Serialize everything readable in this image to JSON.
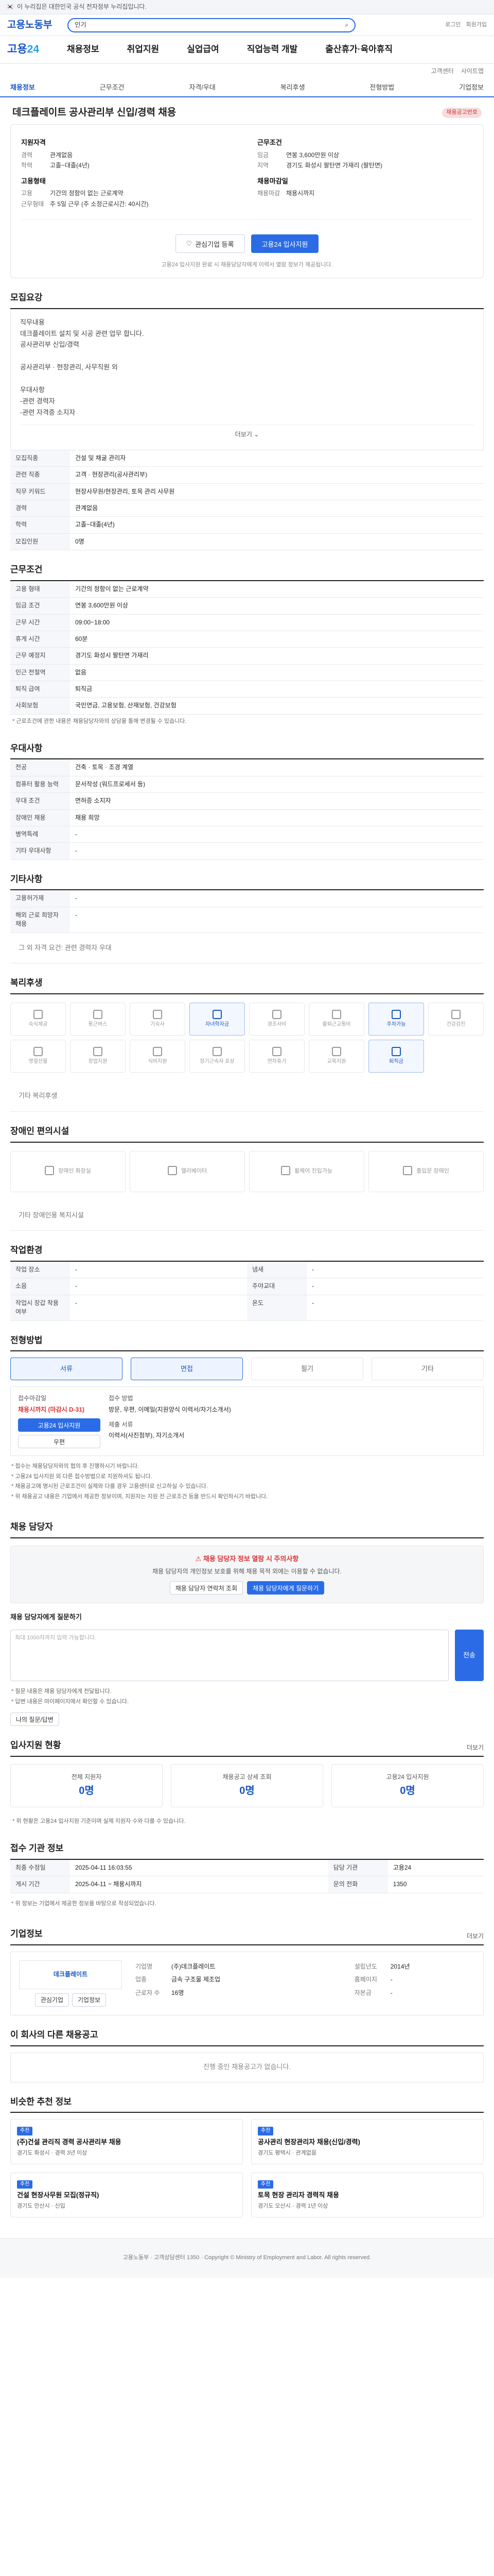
{
  "topbar": {
    "notice": "이 누리집은 대한민국 공식 전자정부 누리집입니다."
  },
  "gnb": {
    "logo": "고용노동부",
    "search_placeholder": "인기",
    "links": [
      "로그인",
      "회원가입"
    ]
  },
  "lnb": {
    "logo1": "고용",
    "logo2": "24",
    "items": [
      "채용정보",
      "취업지원",
      "실업급여",
      "직업능력 개발",
      "출산휴가·육아휴직"
    ]
  },
  "util": [
    "고객센터",
    "사이트맵"
  ],
  "subtabs": [
    "채용정보",
    "근무조건",
    "자격/우대",
    "복리후생",
    "전형방법",
    "기업정보"
  ],
  "notice": {
    "title": "데크플레이트 공사관리부 신입/경력 채용",
    "badge": "채용공고번호"
  },
  "corp": {
    "left_title": "지원자격",
    "left": [
      [
        "경력",
        "관계없음"
      ],
      [
        "학력",
        "고졸~대졸(4년)"
      ]
    ],
    "right_title": "근무조건",
    "right": [
      [
        "임금",
        "연봉 3,600만원 이상"
      ],
      [
        "지역",
        "경기도 화성시 팔탄면 가재리 (팔탄면)"
      ]
    ],
    "left2_title": "고용형태",
    "left2": [
      [
        "고용",
        "기간의 정함이 없는 근로계약"
      ],
      [
        "근무형태",
        "주 5일 근무 (주 소정근로시간: 40시간)"
      ]
    ],
    "right2_title": "채용마감일",
    "right2": [
      [
        "채용마감",
        "채용시까지"
      ]
    ]
  },
  "btns": {
    "save": "관심기업 등록",
    "apply": "고용24 입사지원"
  },
  "hint": "고용24 입사지원 완료 시 채용담당자에게 이력서 열람 정보가 제공됩니다.",
  "job_sect": {
    "title": "모집요강"
  },
  "job_desc": {
    "lines": [
      "직무내용",
      "데크플레이트 설치 및 시공 관련 업무 합니다.",
      "공사관리부 신입/경력",
      "",
      "공사관리부 · 현장관리, 사무직원 외",
      "",
      "우대사항",
      "-관련 경력자",
      "-관련 자격증 소지자"
    ],
    "toggle": "더보기"
  },
  "job_tbl": [
    [
      "모집직종",
      "건설 및 채굴 관리자"
    ],
    [
      "관련 직종",
      "고객 · 현장관리(공사관리부)"
    ],
    [
      "직무 키워드",
      "현장사무원/현장관리, 토목 관리 사무원"
    ],
    [
      "경력",
      "관계없음"
    ],
    [
      "학력",
      "고졸~대졸(4년)"
    ],
    [
      "모집인원",
      "0명"
    ]
  ],
  "cond_sect": {
    "title": "근무조건"
  },
  "cond_tbl": [
    [
      "고용 형태",
      "기간의 정함이 없는 근로계약"
    ],
    [
      "임금 조건",
      "연봉 3,600만원 이상"
    ],
    [
      "근무 시간",
      "09:00~18:00"
    ],
    [
      "휴게 시간",
      "60분"
    ],
    [
      "근무 예정지",
      "경기도 화성시 팔탄면 가재리"
    ],
    [
      "인근 전철역",
      "없음"
    ],
    [
      "퇴직 급여",
      "퇴직금"
    ],
    [
      "사회보험",
      "국민연금, 고용보험, 산재보험, 건강보험"
    ]
  ],
  "cond_note": "* 근로조건에 관한 내용은 채용담당자와의 상담을 통해 변경될 수 있습니다.",
  "pref_sect": {
    "title": "우대사항"
  },
  "pref_tbl": [
    [
      "전공",
      "건축 · 토목 · 조경 계열"
    ],
    [
      "컴퓨터 활용 능력",
      "문서작성 (워드프로세서 등)"
    ],
    [
      "우대 조건",
      "면허증 소지자"
    ],
    [
      "장애인 채용",
      "채용 희망"
    ],
    [
      "병역특례",
      "-"
    ],
    [
      "기타 우대사항",
      "-"
    ]
  ],
  "etc_sect": {
    "title": "기타사항"
  },
  "etc_tbl": [
    [
      "고용허가제",
      "-"
    ],
    [
      "해외 근로 희망자 채용",
      "-"
    ]
  ],
  "etc_note": "그 외 자격 요건: 관련 경력자 우대",
  "welfare_sect": {
    "title": "복리후생"
  },
  "welfare_items": [
    [
      "숙식제공",
      false
    ],
    [
      "통근버스",
      false
    ],
    [
      "기숙사",
      false
    ],
    [
      "자녀학자금",
      true
    ],
    [
      "경조사비",
      false
    ],
    [
      "출퇴근교통비",
      false
    ],
    [
      "주차가능",
      true
    ],
    [
      "건강검진",
      false
    ],
    [
      "명절선물",
      false
    ],
    [
      "창업지원",
      false
    ],
    [
      "식비지원",
      false
    ],
    [
      "장기근속자 포상",
      false
    ],
    [
      "연차휴가",
      false
    ],
    [
      "교육지원",
      false
    ],
    [
      "퇴직금",
      true
    ]
  ],
  "welfare_note": "기타 복리후생",
  "disab_sect": {
    "title": "장애인 편의시설"
  },
  "disab_items": [
    "장애인 화장실",
    "엘리베이터",
    "휠체어 진입가능",
    "출입문 장애인"
  ],
  "disab_note": "기타 장애인용 복지시설",
  "work_sect": {
    "title": "작업환경"
  },
  "work_tbl": [
    [
      "작업 장소",
      "-"
    ],
    [
      "소음",
      "-"
    ],
    [
      "작업시 장갑 착용 여부",
      "-"
    ],
    [
      "냄새",
      "-"
    ],
    [
      "주야교대",
      "-"
    ],
    [
      "온도",
      "-"
    ]
  ],
  "select_sect": {
    "title": "전형방법"
  },
  "select_items": [
    "서류",
    "면접",
    "필기",
    "기타"
  ],
  "apply": {
    "label": "접수마감일",
    "deadline": "채용시까지 (마감시 D-31)",
    "btn1": "고용24 입사지원",
    "btn2": "우편",
    "method_label": "접수 방법",
    "method": "방문, 우편, 이메일(지원양식 이력서/자기소개서)",
    "doc_label": "제출 서류",
    "doc": "이력서(사진첨부), 자기소개서"
  },
  "apply_notes": [
    "* 접수는 채용담당자와의 협의 후 진행하시기 바랍니다.",
    "* 고용24 입사지원 외 다른 접수방법으로 지원하셔도 됩니다.",
    "* 채용공고에 명시된 근로조건이 실제와 다를 경우 고용센터로 신고하실 수 있습니다.",
    "* 위 채용공고 내용은 기업에서 제공한 정보이며, 지원자는 지원 전 근로조건 등을 반드시 확인하시기 바랍니다."
  ],
  "contact_sect": {
    "title": "채용 담당자"
  },
  "warn": {
    "title": "채용 담당자 정보 열람 시 주의사항",
    "text": "채용 담당자의 개인정보 보호를 위해 채용 목적 외에는 이용할 수 없습니다.",
    "b1": "채용 담당자 연락처 조회",
    "b2": "채용 담당자에게 질문하기"
  },
  "qna": {
    "title": "채용 담당자에게 질문하기",
    "placeholder": "최대 1000자까지 입력 가능합니다.",
    "send": "전송"
  },
  "qna_notes": [
    "* 질문 내용은 채용 담당자에게 전달됩니다.",
    "* 답변 내용은 마이페이지에서 확인할 수 있습니다."
  ],
  "qna_btn": "나의 질문/답변",
  "stats_sect": {
    "title": "입사지원 현황",
    "more": "더보기"
  },
  "stats": [
    [
      "전체 지원자",
      "0명"
    ],
    [
      "채용공고 상세 조회",
      "0명"
    ],
    [
      "고용24 입사지원",
      "0명"
    ]
  ],
  "stats_note": "* 위 현황은 고용24 입사지원 기준이며 실제 지원자 수와 다를 수 있습니다.",
  "regist_sect": {
    "title": "접수 기관 정보"
  },
  "regist_tbl": [
    [
      "최종 수정일",
      "2025-04-11 16:03:55"
    ],
    [
      "게시 기간",
      "2025-04-11 ~ 채용시까지"
    ],
    [
      "담당 기관",
      "고용24"
    ],
    [
      "문의 전화",
      "1350"
    ]
  ],
  "regist_notes": [
    "* 위 정보는 기업에서 제공한 정보를 바탕으로 작성되었습니다."
  ],
  "co_sect": {
    "title": "기업정보",
    "more": "더보기"
  },
  "co": {
    "logo": "데크플레이트",
    "b1": "관심기업",
    "b2": "기업정보",
    "rows": [
      [
        "기업명",
        "(주)데크플레이트"
      ],
      [
        "업종",
        "금속 구조물 제조업"
      ],
      [
        "근로자 수",
        "16명"
      ],
      [
        "설립년도",
        "2014년"
      ],
      [
        "홈페이지",
        "-"
      ],
      [
        "자본금",
        "-"
      ]
    ]
  },
  "rec_sect": {
    "title": "이 회사의 다른 채용공고"
  },
  "rec_empty": "진행 중인 채용공고가 없습니다.",
  "sim_sect": {
    "title": "비슷한 추천 정보"
  },
  "sim": [
    {
      "tag": "추천",
      "name": "(주)건설 관리직 경력 공사관리부 채용",
      "meta": "경기도 화성시 · 경력 3년 이상"
    },
    {
      "tag": "추천",
      "name": "공사관리 현장관리자 채용(신입/경력)",
      "meta": "경기도 평택시 · 관계없음"
    },
    {
      "tag": "추천",
      "name": "건설 현장사무원 모집(정규직)",
      "meta": "경기도 안산시 · 신입"
    },
    {
      "tag": "추천",
      "name": "토목 현장 관리자 경력직 채용",
      "meta": "경기도 오산시 · 경력 1년 이상"
    }
  ],
  "footer": "고용노동부 · 고객상담센터 1350 · Copyright © Ministry of Employment and Labor. All rights reserved."
}
